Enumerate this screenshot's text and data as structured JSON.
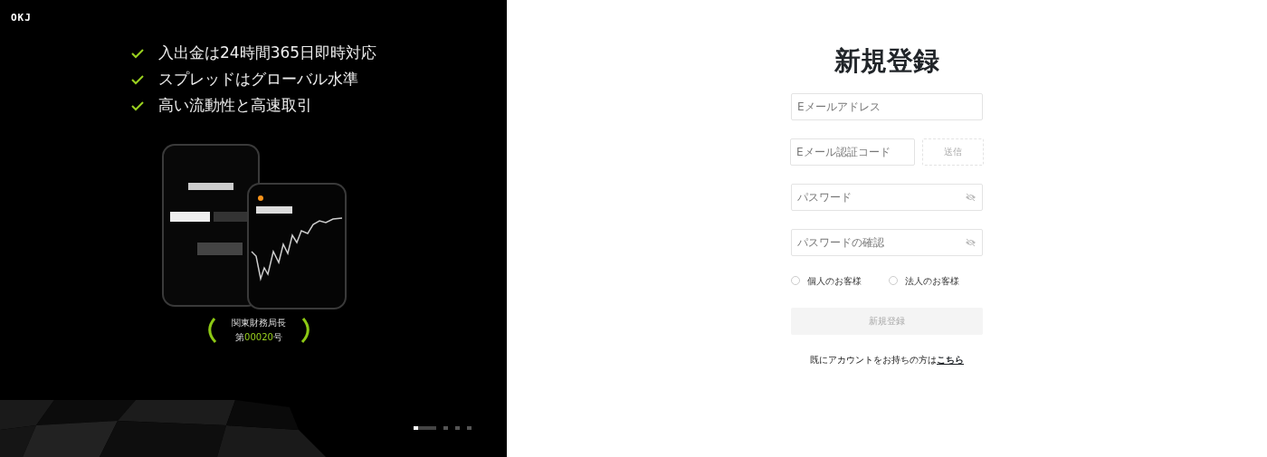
{
  "logo": "OKJ",
  "features": [
    "入出金は24時間365日即時対応",
    "スプレッドはグローバル水準",
    "高い流動性と高速取引"
  ],
  "phones": {
    "kind": "picture"
  },
  "license": {
    "line_1": "関東財務局長",
    "prefix": "第",
    "number": "00020",
    "suffix": "号"
  },
  "carousel": [
    {
      "selected": true
    },
    {
      "selected": false
    },
    {
      "selected": false
    },
    {
      "selected": false
    }
  ],
  "form": {
    "title": "新規登録",
    "email": {
      "placeholder": "Eメールアドレス"
    },
    "code": {
      "placeholder": "Eメール認証コード"
    },
    "send_button": "送信",
    "password": {
      "placeholder": "パスワード"
    },
    "password_confirm": {
      "placeholder": "パスワードの確認"
    },
    "account_types": [
      {
        "label": "個人のお客様",
        "selected": false
      },
      {
        "label": "法人のお客様",
        "selected": false
      }
    ],
    "submit": {
      "label": "新規登録",
      "disabled": true
    },
    "login_prompt": "既にアカウントをお持ちの方は",
    "login_link": "こちら"
  }
}
